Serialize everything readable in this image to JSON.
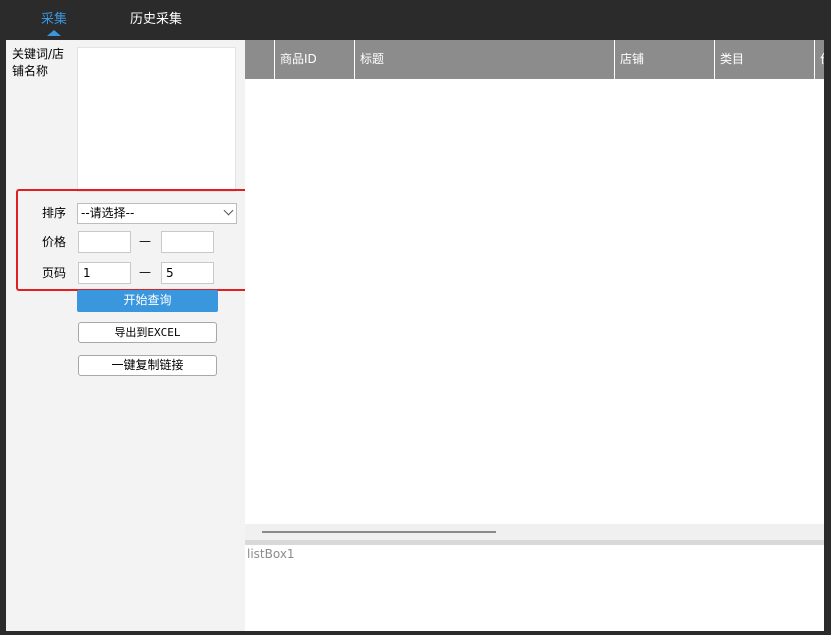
{
  "tabs": [
    {
      "label": "采集",
      "active": true
    },
    {
      "label": "历史采集",
      "active": false
    }
  ],
  "form": {
    "keyword_label_line1": "关键词/店",
    "keyword_label_line2": "铺名称",
    "keyword_value": "",
    "sort_label": "排序",
    "sort_selected": "--请选择--",
    "price_label": "价格",
    "price_min": "",
    "price_max": "",
    "page_label": "页码",
    "page_from": "1",
    "page_to": "5",
    "range_separator": "—"
  },
  "buttons": {
    "start_query": "开始查询",
    "export_excel": "导出到EXCEL",
    "copy_links": "一键复制链接"
  },
  "grid": {
    "columns": [
      "商品ID",
      "标题",
      "店铺",
      "类目",
      "价"
    ]
  },
  "listbox": {
    "placeholder": "listBox1"
  },
  "colors": {
    "accent": "#3a96dd",
    "header": "#8c8c8c",
    "highlight": "#e02020",
    "titlebar": "#2b2b2b"
  }
}
